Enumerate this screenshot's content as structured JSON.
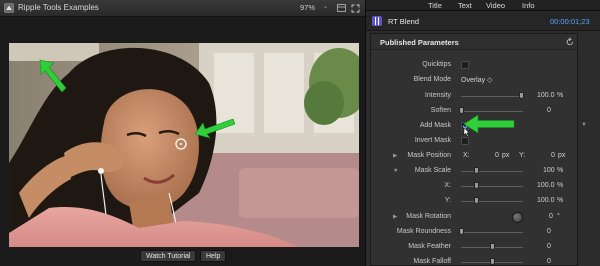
{
  "viewer": {
    "title": "Ripple Tools Examples",
    "zoom": "97%",
    "zoom_caret": "⌄",
    "footer": {
      "watch_tutorial": "Watch Tutorial",
      "help": "Help"
    }
  },
  "inspector": {
    "tabs": [
      "Title",
      "Text",
      "Video",
      "Info"
    ],
    "effect_name": "RT Blend",
    "duration": "00:00:01;23",
    "section_title": "Published Parameters",
    "params": {
      "quicktips": {
        "label": "Quicktips"
      },
      "blend_mode": {
        "label": "Blend Mode",
        "value": "Overlay ◇"
      },
      "intensity": {
        "label": "Intensity",
        "value": "100.0",
        "unit": "%",
        "level": 1.0
      },
      "soften": {
        "label": "Soften",
        "value": "0",
        "level": 0.0
      },
      "add_mask": {
        "label": "Add Mask",
        "checked": true
      },
      "invert_mask": {
        "label": "Invert Mask",
        "checked": false
      },
      "mask_position": {
        "label": "Mask Position",
        "x_label": "X:",
        "x_value": "0",
        "x_unit": "px",
        "y_label": "Y:",
        "y_value": "0",
        "y_unit": "px"
      },
      "mask_scale": {
        "label": "Mask Scale",
        "value": "100",
        "unit": "%",
        "level": 0.25
      },
      "mask_scale_x": {
        "label": "X:",
        "value": "100.0",
        "unit": "%",
        "level": 0.25
      },
      "mask_scale_y": {
        "label": "Y:",
        "value": "100.0",
        "unit": "%",
        "level": 0.25
      },
      "mask_rotation": {
        "label": "Mask Rotation",
        "value": "0",
        "unit": "°"
      },
      "mask_roundness": {
        "label": "Mask Roundness",
        "value": "0",
        "level": 0.0
      },
      "mask_feather": {
        "label": "Mask Feather",
        "value": "0",
        "level": 0.5
      },
      "mask_falloff": {
        "label": "Mask Falloff",
        "value": "0",
        "level": 0.5
      }
    },
    "expand_icon": "▶",
    "collapse_icon": "▼",
    "scroll_arrow": "▼"
  },
  "icons": [
    "app-icon",
    "view-menu-icon",
    "fullscreen-icon",
    "effect-icon",
    "reset-icon",
    "checkmark-icon",
    "cursor-icon",
    "arrow-icon"
  ],
  "colors": {
    "accent_blue": "#59a5ff",
    "arrow_green": "#2fce3a",
    "effect_purple": "#5b57c9"
  }
}
